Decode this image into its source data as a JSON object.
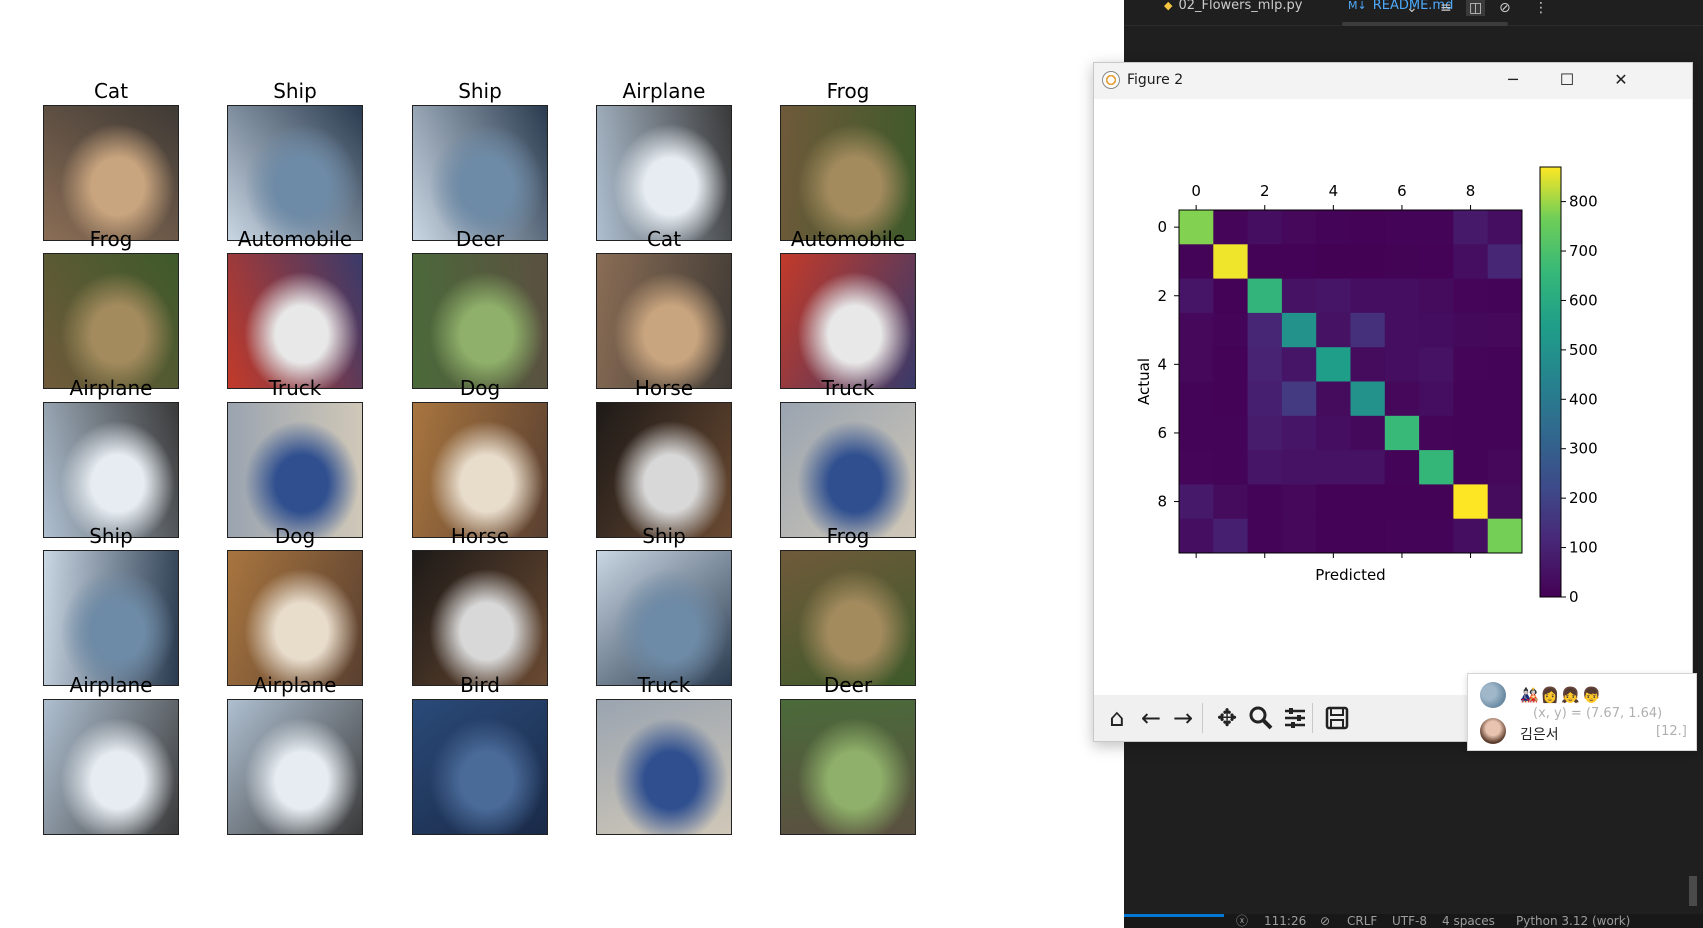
{
  "image_grid": {
    "rows": [
      [
        "Cat",
        "Ship",
        "Ship",
        "Airplane",
        "Frog"
      ],
      [
        "Frog",
        "Automobile",
        "Deer",
        "Cat",
        "Automobile"
      ],
      [
        "Airplane",
        "Truck",
        "Dog",
        "Horse",
        "Truck"
      ],
      [
        "Ship",
        "Dog",
        "Horse",
        "Ship",
        "Frog"
      ],
      [
        "Airplane",
        "Airplane",
        "Bird",
        "Truck",
        "Deer"
      ]
    ]
  },
  "editor": {
    "tabs": [
      {
        "label": "02_Flowers_mlp.py",
        "icon": "python-icon"
      },
      {
        "label": "README.md",
        "icon": "markdown-icon",
        "icon_text": "M↓"
      }
    ],
    "status": {
      "position": "Ln 111, Col 26",
      "position_short": "111:26",
      "eol": "CRLF",
      "encoding": "UTF-8",
      "indent": "4 spaces",
      "language": "Python 3.12 (work)"
    }
  },
  "figure2": {
    "window_title": "Figure 2",
    "toolbar": [
      "home-icon",
      "back-icon",
      "forward-icon",
      "pan-icon",
      "zoom-icon",
      "configure-icon",
      "save-icon"
    ]
  },
  "chart_data": {
    "type": "heatmap",
    "title": "",
    "xlabel": "Predicted",
    "ylabel": "Actual",
    "x_ticks": [
      "0",
      "2",
      "4",
      "6",
      "8"
    ],
    "y_ticks": [
      "0",
      "2",
      "4",
      "6",
      "8"
    ],
    "colormap": "viridis",
    "colorbar_ticks": [
      "0",
      "100",
      "200",
      "300",
      "400",
      "500",
      "600",
      "700",
      "800"
    ],
    "vmin": 0,
    "vmax": 870,
    "matrix": [
      [
        780,
        15,
        40,
        20,
        10,
        5,
        10,
        10,
        70,
        40
      ],
      [
        10,
        860,
        5,
        5,
        3,
        3,
        8,
        5,
        40,
        110
      ],
      [
        60,
        5,
        640,
        50,
        60,
        40,
        40,
        30,
        15,
        10
      ],
      [
        20,
        10,
        110,
        500,
        50,
        140,
        40,
        35,
        25,
        20
      ],
      [
        20,
        5,
        100,
        60,
        550,
        30,
        40,
        50,
        15,
        10
      ],
      [
        10,
        5,
        90,
        170,
        30,
        500,
        20,
        40,
        10,
        10
      ],
      [
        10,
        10,
        80,
        60,
        40,
        25,
        660,
        15,
        10,
        10
      ],
      [
        15,
        10,
        60,
        50,
        50,
        50,
        10,
        650,
        10,
        20
      ],
      [
        70,
        30,
        10,
        20,
        5,
        5,
        5,
        5,
        870,
        30
      ],
      [
        40,
        90,
        10,
        20,
        5,
        5,
        10,
        10,
        40,
        770
      ]
    ]
  },
  "popup": {
    "emoji": "🎎👩👧👦",
    "coordinate_readout": "(x, y) = (7.67, 1.64)",
    "pixel_value": "[12.]",
    "user_name": "김은서"
  },
  "colors": {
    "accent": "#0078d4",
    "editor_bg": "#1f1f1f",
    "readme_tab": "#4daafc"
  }
}
